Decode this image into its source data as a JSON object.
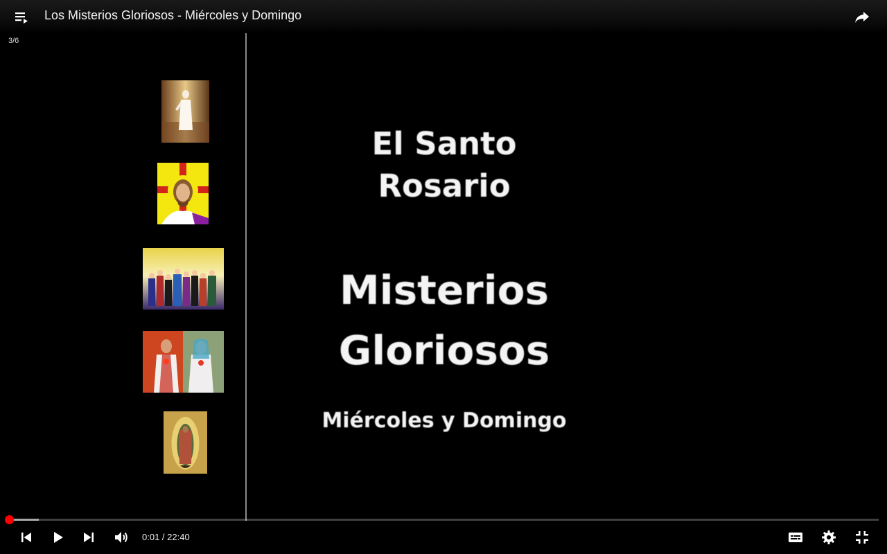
{
  "window": {
    "title": "Los Misterios Gloriosos - Miércoles y Domingo"
  },
  "topbar": {
    "playlist_icon": "playlist-icon",
    "share_icon": "share-icon"
  },
  "player": {
    "slide_counter": "3/6",
    "progress_fraction": 0.0,
    "buffer_fraction": 0.035,
    "time": {
      "current": "0:01",
      "separator": " / ",
      "duration": "22:40"
    },
    "accent_color": "#ff0000"
  },
  "slide": {
    "line1": "El Santo",
    "line2": "Rosario",
    "line3": "Misterios",
    "line4": "Gloriosos",
    "line5": "Miércoles y Domingo"
  },
  "thumbnails": [
    "resurrection",
    "jesus-halo",
    "pentecost",
    "sacred-hearts",
    "guadalupe"
  ],
  "controls": {
    "left": [
      "previous-icon",
      "play-icon",
      "next-icon",
      "volume-icon"
    ],
    "right": [
      "captions-icon",
      "settings-icon",
      "exit-fullscreen-icon"
    ]
  }
}
